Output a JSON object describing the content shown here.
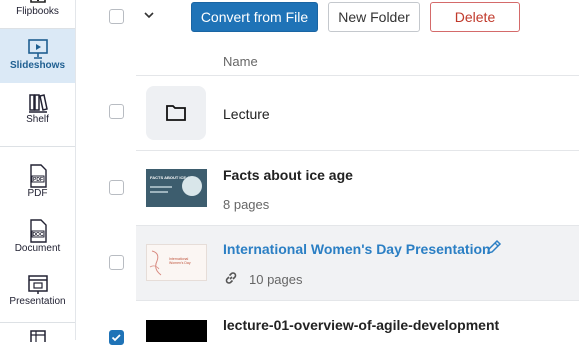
{
  "sidebar": {
    "items": [
      {
        "label": "Flipbooks",
        "icon": "flipbook-icon"
      },
      {
        "label": "Slideshows",
        "icon": "slideshow-icon",
        "active": true
      },
      {
        "label": "Shelf",
        "icon": "shelf-icon"
      },
      {
        "label": "PDF",
        "icon": "pdf-file-icon"
      },
      {
        "label": "Document",
        "icon": "doc-file-icon"
      },
      {
        "label": "Presentation",
        "icon": "presentation-icon"
      }
    ]
  },
  "toolbar": {
    "convert_label": "Convert from File",
    "new_folder_label": "New Folder",
    "delete_label": "Delete"
  },
  "list": {
    "column_name": "Name",
    "rows": [
      {
        "type": "folder",
        "title": "Lecture"
      },
      {
        "type": "file",
        "title": "Facts about ice age",
        "pages": "8 pages",
        "thumb_text": "FACTS ABOUT ICE AGE"
      },
      {
        "type": "file",
        "title": "International Women's Day Presentation",
        "pages": "10 pages",
        "link": true,
        "edit_icon": "pencil-icon",
        "share_icon": "link-icon",
        "thumb_text": "International Women's Day"
      },
      {
        "type": "file",
        "title": "lecture-01-overview-of-agile-development",
        "checked": true
      }
    ]
  },
  "colors": {
    "primary": "#1f73b7",
    "danger": "#c0392b",
    "link": "#2b7fc4",
    "active_bg": "#dbe9f6"
  }
}
